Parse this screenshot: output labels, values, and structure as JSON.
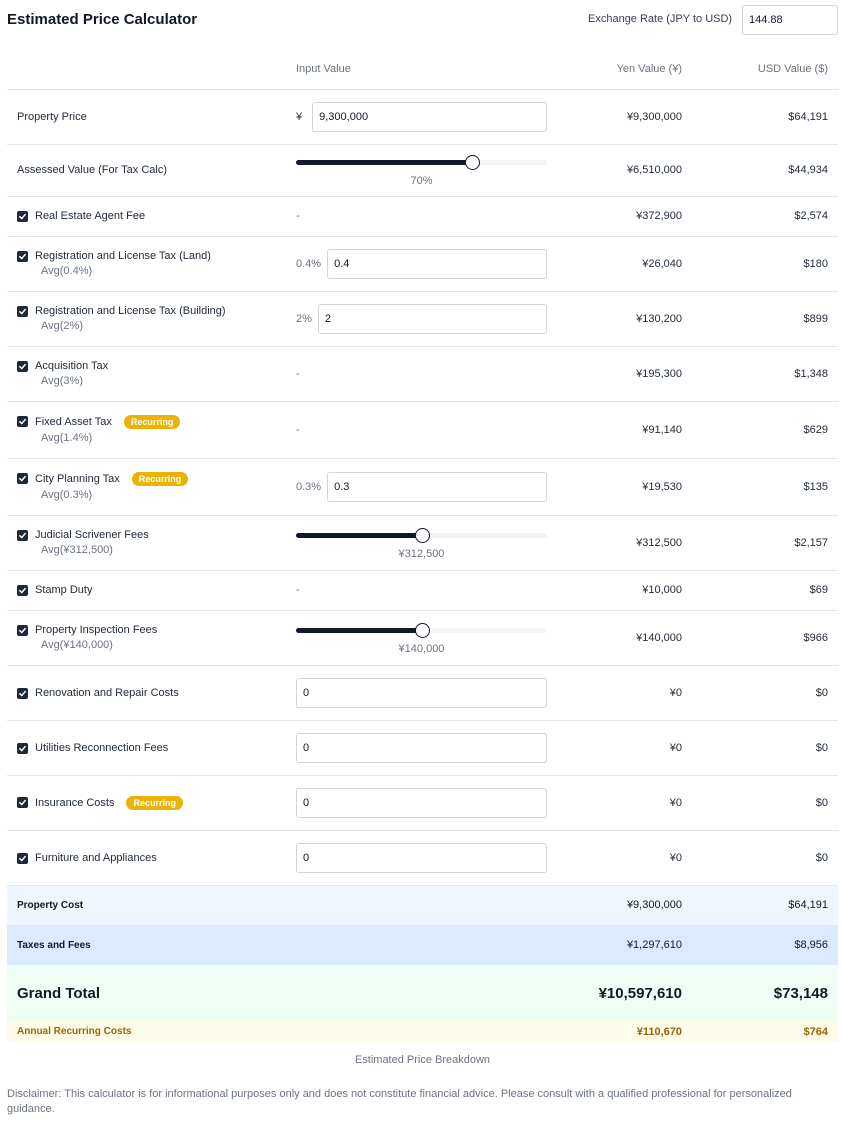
{
  "header": {
    "title": "Estimated Price Calculator",
    "exchange_rate_label": "Exchange Rate (JPY to USD)",
    "exchange_rate_value": "144.88"
  },
  "columns": {
    "input": "Input Value",
    "yen": "Yen Value (¥)",
    "usd": "USD Value ($)"
  },
  "rows": {
    "property_price": {
      "label": "Property Price",
      "prefix": "¥",
      "input": "9,300,000",
      "yen": "¥9,300,000",
      "usd": "$64,191"
    },
    "assessed_value": {
      "label": "Assessed Value (For Tax Calc)",
      "slider_fraction": 0.7,
      "slider_label": "70%",
      "yen": "¥6,510,000",
      "usd": "$44,934"
    },
    "agent_fee": {
      "label": "Real Estate Agent Fee",
      "checked": true,
      "input": "-",
      "yen": "¥372,900",
      "usd": "$2,574"
    },
    "reg_tax_land": {
      "label": "Registration and License Tax (Land)",
      "sub": "Avg(0.4%)",
      "checked": true,
      "pct": "0.4%",
      "input": "0.4",
      "yen": "¥26,040",
      "usd": "$180"
    },
    "reg_tax_building": {
      "label": "Registration and License Tax (Building)",
      "sub": "Avg(2%)",
      "checked": true,
      "pct": "2%",
      "input": "2",
      "yen": "¥130,200",
      "usd": "$899"
    },
    "acquisition_tax": {
      "label": "Acquisition Tax",
      "sub": "Avg(3%)",
      "checked": true,
      "input": "-",
      "yen": "¥195,300",
      "usd": "$1,348"
    },
    "fixed_asset_tax": {
      "label": "Fixed Asset Tax",
      "badge": "Recurring",
      "sub": "Avg(1.4%)",
      "checked": true,
      "input": "-",
      "yen": "¥91,140",
      "usd": "$629"
    },
    "city_planning_tax": {
      "label": "City Planning Tax",
      "badge": "Recurring",
      "sub": "Avg(0.3%)",
      "checked": true,
      "pct": "0.3%",
      "input": "0.3",
      "yen": "¥19,530",
      "usd": "$135"
    },
    "judicial_fees": {
      "label": "Judicial Scrivener Fees",
      "sub": "Avg(¥312,500)",
      "checked": true,
      "slider_fraction": 0.5,
      "slider_label": "¥312,500",
      "yen": "¥312,500",
      "usd": "$2,157"
    },
    "stamp_duty": {
      "label": "Stamp Duty",
      "checked": true,
      "input": "-",
      "yen": "¥10,000",
      "usd": "$69"
    },
    "inspection_fees": {
      "label": "Property Inspection Fees",
      "sub": "Avg(¥140,000)",
      "checked": true,
      "slider_fraction": 0.5,
      "slider_label": "¥140,000",
      "yen": "¥140,000",
      "usd": "$966"
    },
    "renovation": {
      "label": "Renovation and Repair Costs",
      "checked": true,
      "input": "0",
      "yen": "¥0",
      "usd": "$0"
    },
    "utilities": {
      "label": "Utilities Reconnection Fees",
      "checked": true,
      "input": "0",
      "yen": "¥0",
      "usd": "$0"
    },
    "insurance": {
      "label": "Insurance Costs",
      "badge": "Recurring",
      "checked": true,
      "input": "0",
      "yen": "¥0",
      "usd": "$0"
    },
    "furniture": {
      "label": "Furniture and Appliances",
      "checked": true,
      "input": "0",
      "yen": "¥0",
      "usd": "$0"
    }
  },
  "summary": {
    "property_cost": {
      "label": "Property Cost",
      "yen": "¥9,300,000",
      "usd": "$64,191"
    },
    "taxes_fees": {
      "label": "Taxes and Fees",
      "yen": "¥1,297,610",
      "usd": "$8,956"
    },
    "grand_total": {
      "label": "Grand Total",
      "yen": "¥10,597,610",
      "usd": "$73,148"
    },
    "annual_recurring": {
      "label": "Annual Recurring Costs",
      "yen": "¥110,670",
      "usd": "$764"
    }
  },
  "caption": "Estimated Price Breakdown",
  "disclaimer": "Disclaimer: This calculator is for informational purposes only and does not constitute financial advice. Please consult with a qualified professional for personalized guidance.",
  "icons": {
    "checkbox": "checkmark-icon"
  },
  "colors": {
    "accent": "#111827",
    "badge": "#eab308",
    "property_cost_bg": "#eff6ff",
    "taxes_bg": "#dbeafe",
    "grand_bg": "#f0fdf4",
    "annual_bg": "#fefce8",
    "annual_text": "#a16207"
  }
}
